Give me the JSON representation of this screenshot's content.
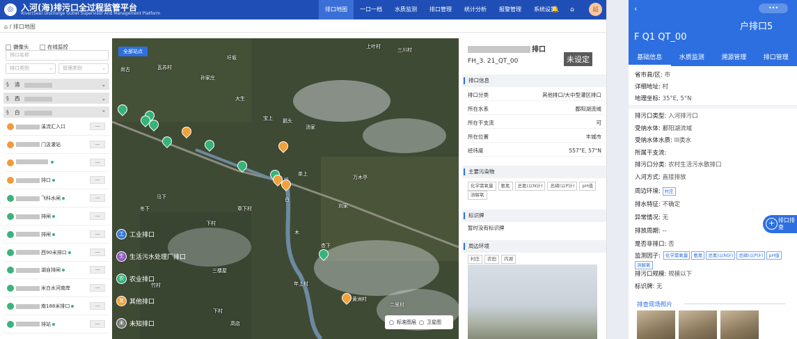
{
  "app": {
    "logo_char": "◎",
    "title": "入河(海)排污口全过程监管平台",
    "subtitle": "River(Sea) Discharge Outlet Supervisor And Management Platform",
    "nav": [
      "排口地图",
      "一口一档",
      "水质监测",
      "排口管理",
      "统计分析",
      "报警管理",
      "系统设置"
    ],
    "avatar": "超"
  },
  "icons": {
    "bell": "🔔",
    "home": "⌂",
    "back": "‹",
    "more": "•••",
    "chevron": "⌄",
    "plus": "+"
  },
  "breadcrumb": "排口地图",
  "sidebar": {
    "filters": [
      "摄像头",
      "在线监控"
    ],
    "search_placeholder": "排口名称",
    "type_placeholder": "排口类别",
    "manage_placeholder": "管理类别",
    "groups": [
      {
        "label": "清",
        "chev": "⌄"
      },
      {
        "label": "西",
        "chev": "⌄"
      },
      {
        "label": "白",
        "chev": "⌃"
      }
    ],
    "rows": [
      {
        "icon": "o",
        "text": "溪流汇入口",
        "dot": false
      },
      {
        "icon": "o",
        "text": "门汲灌站",
        "dot": false
      },
      {
        "icon": "o",
        "text": "",
        "dot": true
      },
      {
        "icon": "o",
        "text": "排口",
        "dot": true
      },
      {
        "icon": "g",
        "text": "飞科水闸",
        "dot": true
      },
      {
        "icon": "g",
        "text": "排闸",
        "dot": true
      },
      {
        "icon": "g",
        "text": "排闸",
        "dot": true
      },
      {
        "icon": "g",
        "text": "西90米排口",
        "dot": true
      },
      {
        "icon": "g",
        "text": "湖自排闸",
        "dot": true
      },
      {
        "icon": "g",
        "text": "米白水河南岸",
        "dot": false
      },
      {
        "icon": "g",
        "text": "南188米排口",
        "dot": true
      },
      {
        "icon": "g",
        "text": "排站",
        "dot": true
      }
    ],
    "row_btn": "---"
  },
  "map": {
    "all_sites_btn": "全部站点",
    "labels": [
      "三川村",
      "上叶村",
      "尚古",
      "瓦苏村",
      "孙家庄",
      "圩坂",
      "大生",
      "宝上",
      "鹅头",
      "汤家",
      "万木亭",
      "茶上",
      "冬下",
      "白",
      "木",
      "刘家",
      "马下",
      "下村",
      "章下村",
      "三楼屋",
      "杏下",
      "年上村",
      "黄洲村",
      "二里村",
      "下村",
      "高店",
      "竹村"
    ],
    "legend": [
      {
        "label": "工业排口",
        "color": "#3a7bd5",
        "icon": "工"
      },
      {
        "label": "生活污水处理厂排口",
        "color": "#8e5bbf",
        "icon": "生"
      },
      {
        "label": "农业排口",
        "color": "#35b37a",
        "icon": "农"
      },
      {
        "label": "其他排口",
        "color": "#f2a03a",
        "icon": "其"
      },
      {
        "label": "未知排口",
        "color": "#777777",
        "icon": "未"
      }
    ],
    "layer_std": "标准图层",
    "layer_sat": "卫星图"
  },
  "info": {
    "title": "排口",
    "code": "FH_3.          21_QT_00",
    "tag": "未设定",
    "sec_info": "排口信息",
    "fields": [
      {
        "k": "排口分类",
        "v": "其他排口/大中型灌区排口"
      },
      {
        "k": "所在水系",
        "v": "鄱阳湖流域"
      },
      {
        "k": "所在干支流",
        "v": "可"
      },
      {
        "k": "所在位置",
        "v": "丰城市"
      },
      {
        "k": "经纬度",
        "v": "557°E,        57°N"
      }
    ],
    "sec_poll": "主要污染物",
    "pollutants": [
      "化学需氧量",
      "氨氮",
      "总氮(以N计)",
      "总磷(以P计)",
      "pH值",
      "溶解氧"
    ],
    "sec_sign": "标识牌",
    "sign_text": "暂时没有标识牌",
    "sec_env": "周边环境",
    "env_tags": [
      "村庄",
      "农田",
      "内湖"
    ]
  },
  "phone": {
    "name": "户排口5",
    "code": "F      Q1     QT_00",
    "tabs": [
      "基础信息",
      "水质监测",
      "溯源管理",
      "排口管理"
    ],
    "g1": [
      {
        "k": "省市县/区:",
        "v": "市"
      },
      {
        "k": "详细地址:",
        "v": "村"
      },
      {
        "k": "地理坐标:",
        "v": "35°E,        5°N"
      }
    ],
    "g2": [
      {
        "k": "排污口类型:",
        "v": "入河排污口"
      },
      {
        "k": "受纳水体:",
        "v": "鄱阳湖流域"
      },
      {
        "k": "受纳水体水质:",
        "v": "III类水"
      },
      {
        "k": "所属干支流:",
        "v": ""
      },
      {
        "k": "排污口分类:",
        "v": "农村生活污水散排口"
      },
      {
        "k": "入河方式:",
        "v": "直接排放"
      }
    ],
    "env_k": "周边环境:",
    "env_tag": "村庄",
    "g3": [
      {
        "k": "排水特征:",
        "v": "不确定"
      },
      {
        "k": "异常情况:",
        "v": "无"
      },
      {
        "k": "排放周期:",
        "v": "--"
      },
      {
        "k": "是否非排口:",
        "v": "否"
      }
    ],
    "factors_k": "监测因子:",
    "factors": [
      "化学需氧量",
      "氨氮",
      "总氮(以N计)",
      "总磷(以P计)",
      "pH值",
      "溶解氧"
    ],
    "g4": [
      {
        "k": "排污口规模:",
        "v": "规模以下"
      },
      {
        "k": "标识牌:",
        "v": "无"
      }
    ],
    "float_btn": "排口排查",
    "photos_title": "排查现场照片"
  }
}
